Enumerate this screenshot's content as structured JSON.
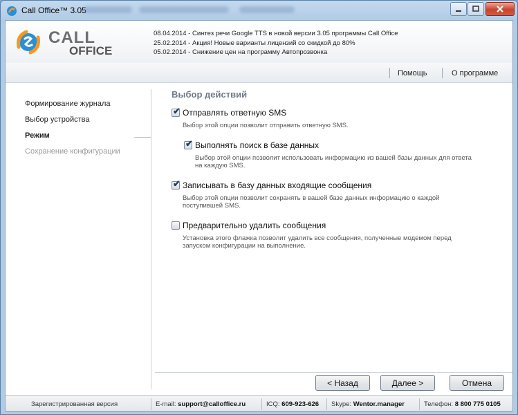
{
  "window": {
    "title": "Call Office™ 3.05"
  },
  "header": {
    "logo_line1": "CALL",
    "logo_line2": "OFFICE",
    "news": [
      "08.04.2014 - Синтез речи Google TTS в новой версии 3.05 программы Call Office",
      "25.02.2014 - Акция! Новые варианты лицензий со скидкой до 80%",
      "05.02.2014 - Снижение цен на программу Автопрозвонка"
    ]
  },
  "menu": {
    "help": "Помощь",
    "about": "О программе"
  },
  "nav": {
    "items": [
      {
        "label": "Формирование журнала"
      },
      {
        "label": "Выбор устройства"
      },
      {
        "label": "Режим"
      },
      {
        "label": "Сохранение конфигурации"
      }
    ]
  },
  "content": {
    "title": "Выбор действий",
    "options": [
      {
        "label": "Отправлять ответную SMS",
        "checked": true,
        "desc": "Выбор этой опции позволит отправить ответную SMS."
      },
      {
        "label": "Выполнять поиск в базе данных",
        "checked": true,
        "desc_l1": "Выбор этой опции позволит использовать информацию из вашей базы данных для ответа",
        "desc_l2": "на каждую SMS."
      },
      {
        "label": "Записывать в базу данных входящие сообщения",
        "checked": true,
        "desc_l1": "Выбор этой опции позволит сохранять в вашей базе данных информацию о каждой",
        "desc_l2": "поступившей SMS."
      },
      {
        "label": "Предварительно удалить сообщения",
        "checked": false,
        "desc_l1": "Установка этого флажка позволит удалить все сообщения, полученные модемом перед",
        "desc_l2": "запуском конфигурации на выполнение."
      }
    ]
  },
  "buttons": {
    "back": "< Назад",
    "next": "Далее >",
    "cancel": "Отмена"
  },
  "status": {
    "registered": "Зарегистрированная версия",
    "email_label": "E-mail:",
    "email": "support@calloffice.ru",
    "icq_label": "ICQ:",
    "icq": "609-923-626",
    "skype_label": "Skype:",
    "skype": "Wentor.manager",
    "phone_label": "Телефон:",
    "phone": "8 800 775 0105"
  },
  "colors": {
    "accent_orange": "#f39a1e",
    "logo_blue": "#2a8fd6",
    "logo_gray": "#6f6f6f"
  }
}
